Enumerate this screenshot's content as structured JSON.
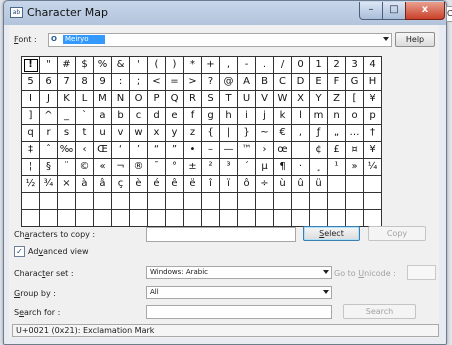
{
  "window": {
    "title": "Character Map",
    "app_icon_glyph": "ab",
    "minimize": "–",
    "maximize": "□",
    "close": "x",
    "edge_letter": "C"
  },
  "font": {
    "label_prefix": "F",
    "label_rest": "ont :",
    "value": "Meiryo",
    "icon_glyph": "O",
    "help_label": "Help"
  },
  "characters": [
    "!",
    "\"",
    "#",
    "$",
    "%",
    "&",
    "'",
    "(",
    ")",
    "*",
    "+",
    ",",
    "-",
    ".",
    "/",
    "0",
    "1",
    "2",
    "3",
    "4",
    "5",
    "6",
    "7",
    "8",
    "9",
    ":",
    ";",
    "<",
    "=",
    ">",
    "?",
    "@",
    "A",
    "B",
    "C",
    "D",
    "E",
    "F",
    "G",
    "H",
    "I",
    "J",
    "K",
    "L",
    "M",
    "N",
    "O",
    "P",
    "Q",
    "R",
    "S",
    "T",
    "U",
    "V",
    "W",
    "X",
    "Y",
    "Z",
    "[",
    "¥",
    "]",
    "^",
    "_",
    "`",
    "a",
    "b",
    "c",
    "d",
    "e",
    "f",
    "g",
    "h",
    "i",
    "j",
    "k",
    "l",
    "m",
    "n",
    "o",
    "p",
    "q",
    "r",
    "s",
    "t",
    "u",
    "v",
    "w",
    "x",
    "y",
    "z",
    "{",
    "|",
    "}",
    "~",
    "€",
    ",",
    "ƒ",
    "„",
    "…",
    "†",
    "‡",
    "ˆ",
    "‰",
    "‹",
    "Œ",
    "‘",
    "’",
    "“",
    "”",
    "•",
    "–",
    "—",
    "™",
    "›",
    "œ",
    " ",
    "¢",
    "£",
    "¤",
    "¥",
    "¦",
    "§",
    "¨",
    "©",
    "«",
    "¬",
    "®",
    "¯",
    "°",
    "±",
    "²",
    "³",
    "´",
    "µ",
    "¶",
    "·",
    "¸",
    "¹",
    "»",
    "¼",
    "½",
    "¾",
    "×",
    "à",
    "â",
    "ç",
    "è",
    "é",
    "ê",
    "ë",
    "î",
    "ï",
    "ô",
    "÷",
    "ù",
    "û",
    "ü",
    "",
    "",
    "",
    "",
    "",
    "",
    "",
    "",
    "",
    "",
    "",
    "",
    "",
    "",
    "",
    "",
    "",
    "",
    "",
    "",
    "",
    "",
    "",
    "",
    "",
    "",
    "",
    "",
    "",
    "",
    "",
    "",
    "",
    "",
    "",
    "",
    "",
    "",
    "",
    "",
    "",
    "",
    ""
  ],
  "selected_index": 0,
  "copy": {
    "label_prefix": "Ch",
    "label_u": "a",
    "label_rest": "racters to copy :",
    "value": "",
    "select_prefix": "",
    "select_u": "S",
    "select_rest": "elect",
    "copy_label": "Copy"
  },
  "advanced": {
    "checked": "✓",
    "label_prefix": "Ad",
    "label_u": "v",
    "label_rest": "anced view"
  },
  "charset": {
    "label_prefix": "Charac",
    "label_u": "t",
    "label_rest": "er set :",
    "value": "Windows: Arabic",
    "goto_prefix": "Go to ",
    "goto_u": "U",
    "goto_rest": "nicode :",
    "goto_value": ""
  },
  "group": {
    "label_u": "G",
    "label_rest": "roup by :",
    "value": "All"
  },
  "search": {
    "label_prefix": "S",
    "label_u": "e",
    "label_rest": "arch for :",
    "value": "",
    "button": "Search"
  },
  "status": "U+0021 (0x21): Exclamation Mark"
}
